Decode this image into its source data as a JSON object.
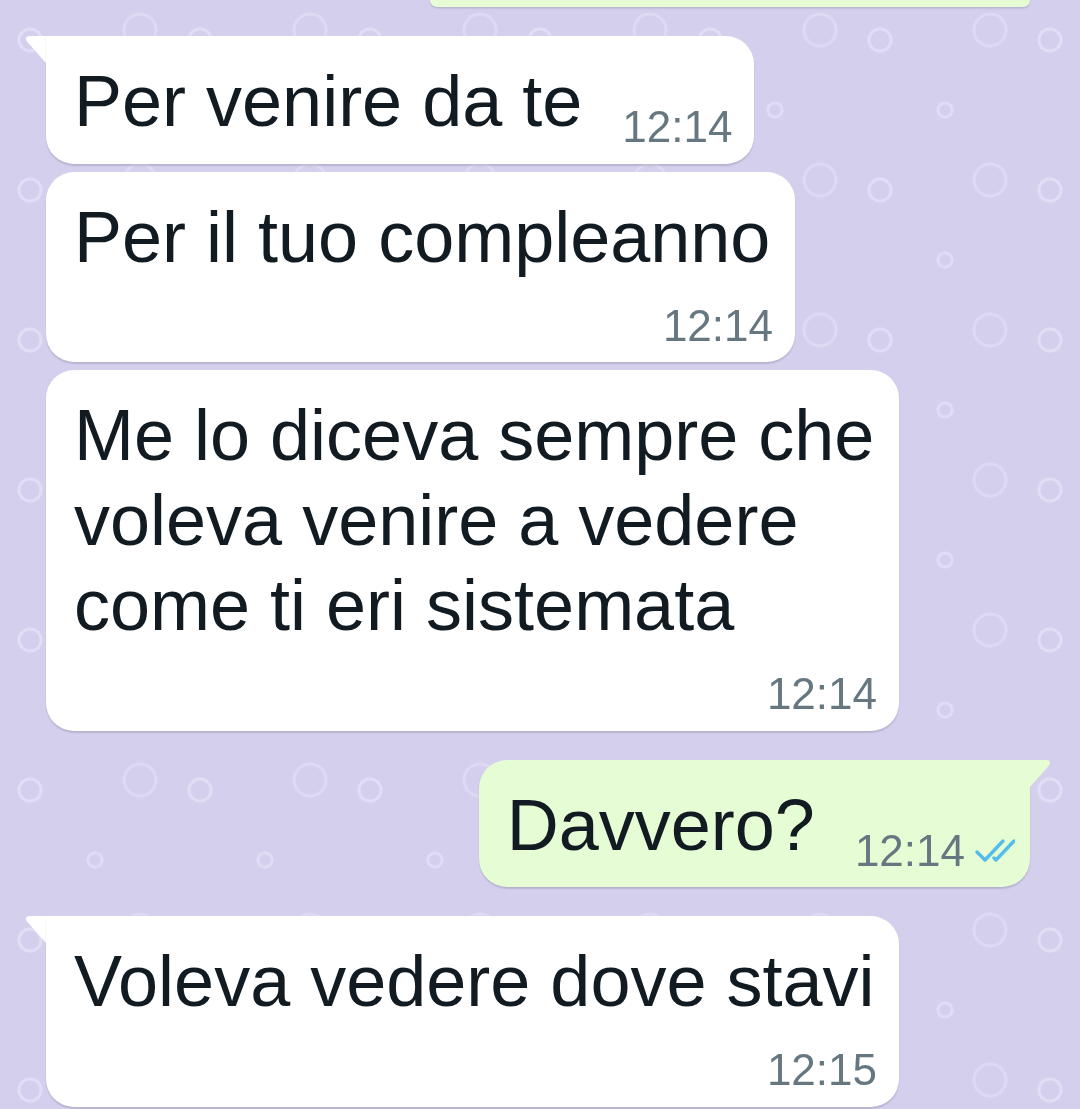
{
  "chat": {
    "messages": [
      {
        "kind": "clipped",
        "outgoing": true
      },
      {
        "kind": "text",
        "outgoing": false,
        "tail": true,
        "text": "Per venire da te",
        "time": "12:14"
      },
      {
        "kind": "text",
        "outgoing": false,
        "tail": false,
        "text": "Per il tuo compleanno",
        "time": "12:14"
      },
      {
        "kind": "text",
        "outgoing": false,
        "tail": false,
        "text": "Me lo diceva sempre che voleva venire a vedere come ti eri sistemata",
        "time": "12:14"
      },
      {
        "kind": "text",
        "outgoing": true,
        "tail": true,
        "text": "Davvero?",
        "time": "12:14",
        "read": true
      },
      {
        "kind": "text",
        "outgoing": false,
        "tail": true,
        "text": "Voleva vedere dove stavi",
        "time": "12:15"
      }
    ]
  }
}
